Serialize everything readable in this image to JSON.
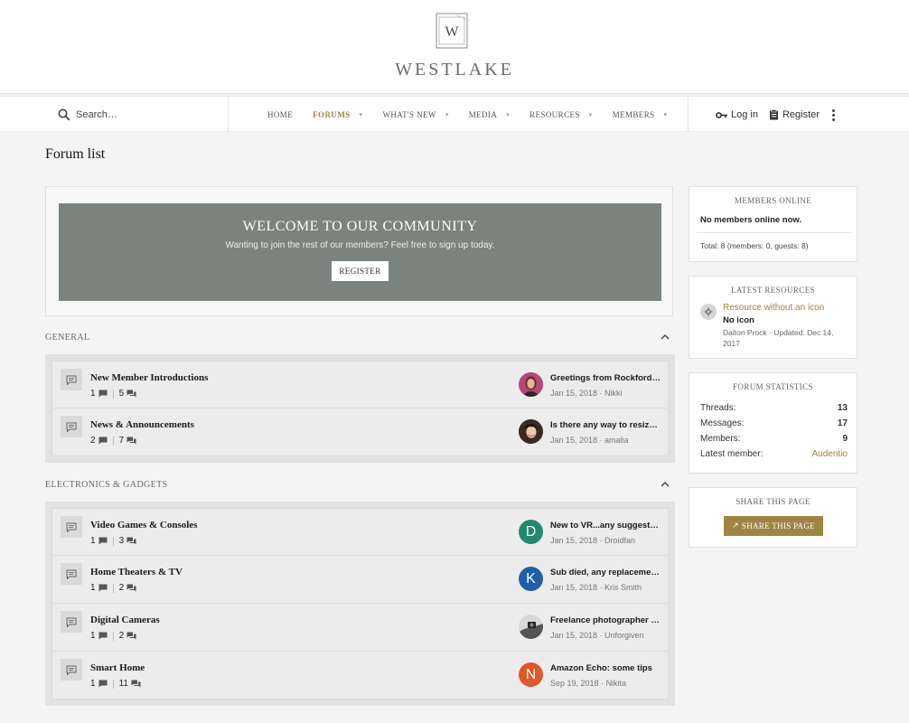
{
  "site": {
    "name": "WESTLAKE",
    "logo_letter": "W"
  },
  "search": {
    "label": "Search…"
  },
  "nav": [
    {
      "label": "HOME",
      "active": false,
      "dropdown": false
    },
    {
      "label": "FORUMS",
      "active": true,
      "dropdown": true
    },
    {
      "label": "WHAT'S NEW",
      "active": false,
      "dropdown": true
    },
    {
      "label": "MEDIA",
      "active": false,
      "dropdown": true
    },
    {
      "label": "RESOURCES",
      "active": false,
      "dropdown": true
    },
    {
      "label": "MEMBERS",
      "active": false,
      "dropdown": true
    }
  ],
  "account": {
    "login": "Log in",
    "register": "Register"
  },
  "page": {
    "title": "Forum list"
  },
  "welcome": {
    "title": "WELCOME TO OUR COMMUNITY",
    "text": "Wanting to join the rest of our members? Feel free to sign up today.",
    "button": "REGISTER"
  },
  "categories": [
    {
      "title": "GENERAL",
      "forums": [
        {
          "title": "New Member Introductions",
          "threads": "1",
          "messages": "5",
          "last_title": "Greetings from Rockford, IL",
          "last_date": "Jan 15, 2018",
          "last_user": "Nikki",
          "avatar": "photo-woman",
          "avatar_color": "#b04a7a"
        },
        {
          "title": "News & Announcements",
          "threads": "2",
          "messages": "7",
          "last_title": "Is there any way to resize images?",
          "last_date": "Jan 15, 2018",
          "last_user": "amalia",
          "avatar": "photo-woman-2",
          "avatar_color": "#3a2a22"
        }
      ]
    },
    {
      "title": "ELECTRONICS & GADGETS",
      "forums": [
        {
          "title": "Video Games & Consoles",
          "threads": "1",
          "messages": "3",
          "last_title": "New to VR...any suggestions?",
          "last_date": "Jan 15, 2018",
          "last_user": "Droidfan",
          "avatar": "D",
          "avatar_color": "#1f8a6e"
        },
        {
          "title": "Home Theaters & TV",
          "threads": "1",
          "messages": "2",
          "last_title": "Sub died, any replacement suggestions?",
          "last_date": "Jan 15, 2018",
          "last_user": "Kris Smith",
          "avatar": "K",
          "avatar_color": "#1d5fa8"
        },
        {
          "title": "Digital Cameras",
          "threads": "1",
          "messages": "2",
          "last_title": "Freelance photographer looking for advice",
          "last_date": "Jan 15, 2018",
          "last_user": "Unforgiven",
          "avatar": "photo-camera",
          "avatar_color": "#8a8a8a"
        },
        {
          "title": "Smart Home",
          "threads": "1",
          "messages": "11",
          "last_title": "Amazon Echo: some tips",
          "last_date": "Sep 19, 2018",
          "last_user": "Nikita",
          "avatar": "N",
          "avatar_color": "#e0592a"
        }
      ]
    }
  ],
  "sidebar": {
    "members_online": {
      "title": "MEMBERS ONLINE",
      "text": "No members online now.",
      "total": "Total: 8 (members: 0, guests: 8)"
    },
    "latest_resources": {
      "title": "LATEST RESOURCES",
      "resource_title": "Resource without an icon",
      "resource_desc": "No icon",
      "resource_meta": "Dalton Prock · Updated: Dec 14, 2017"
    },
    "forum_stats": {
      "title": "FORUM STATISTICS",
      "rows": [
        {
          "label": "Threads:",
          "value": "13"
        },
        {
          "label": "Messages:",
          "value": "17"
        },
        {
          "label": "Members:",
          "value": "9"
        },
        {
          "label": "Latest member:",
          "value": "Audentio"
        }
      ]
    },
    "share": {
      "title": "SHARE THIS PAGE",
      "button": "SHARE THIS PAGE"
    }
  },
  "colors": {
    "accent": "#a08542",
    "welcome_bg": "#7a837d"
  }
}
